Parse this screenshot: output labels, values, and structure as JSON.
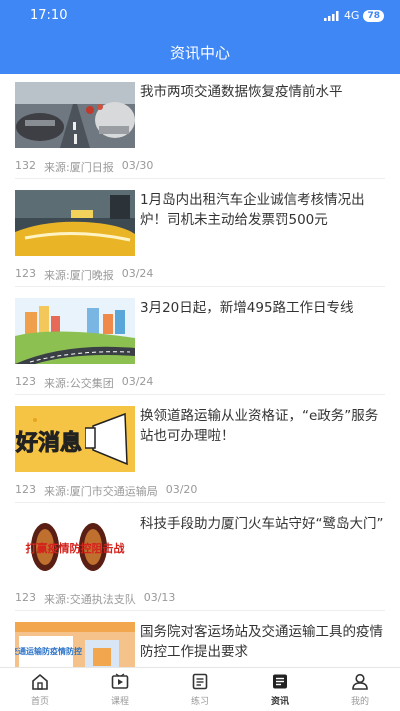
{
  "status_bar": {
    "time": "17:10",
    "network": "4G",
    "battery": "78"
  },
  "header": {
    "title": "资讯中心"
  },
  "articles": [
    {
      "title": "我市两项交通数据恢复疫情前水平",
      "views": "132",
      "source": "来源:厦门日报",
      "date": "03/30",
      "thumb": "traffic-street-photo"
    },
    {
      "title": "1月岛内出租汽车企业诚信考核情况出炉！司机未主动给发票罚500元",
      "views": "123",
      "source": "来源:厦门晚报",
      "date": "03/24",
      "thumb": "taxi-photo"
    },
    {
      "title": "3月20日起，新增495路工作日专线",
      "views": "123",
      "source": "来源:公交集团",
      "date": "03/24",
      "thumb": "city-road-illustration"
    },
    {
      "title": "换领道路运输从业资格证，“e政务”服务站也可办理啦！",
      "views": "123",
      "source": "来源:厦门市交通运输局",
      "date": "03/20",
      "thumb": "good-news-graphic",
      "thumb_text": "好消息"
    },
    {
      "title": "科技手段助力厦门火车站守好“鹭岛大门”",
      "views": "123",
      "source": "来源:交通执法支队",
      "date": "03/13",
      "thumb": "epidemic-fight-banner",
      "thumb_text": "打赢疫情防控阻击战"
    },
    {
      "title": "国务院对客运场站及交通运输工具的疫情防控工作提出要求",
      "views": "",
      "source": "",
      "date": "",
      "thumb": "epidemic-control-poster",
      "thumb_text": "交通运输防疫情防控"
    }
  ],
  "tabbar": {
    "items": [
      {
        "label": "首页",
        "icon": "home-icon"
      },
      {
        "label": "课程",
        "icon": "video-icon"
      },
      {
        "label": "练习",
        "icon": "document-icon"
      },
      {
        "label": "资讯",
        "icon": "news-icon",
        "active": true
      },
      {
        "label": "我的",
        "icon": "person-icon"
      }
    ]
  },
  "colors": {
    "primary": "#3f87f5",
    "text": "#333333",
    "muted": "#999999"
  }
}
